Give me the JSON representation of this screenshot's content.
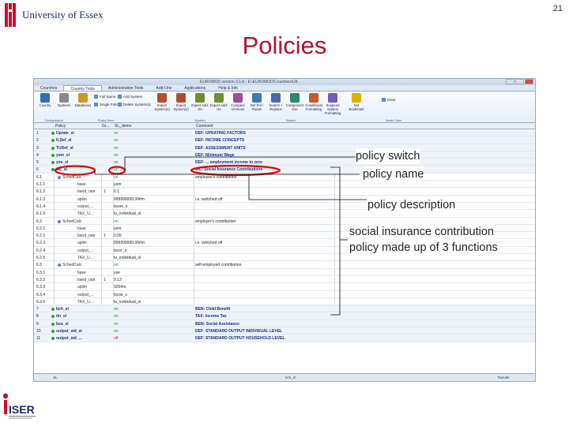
{
  "slide": {
    "logo_text": "University of Essex",
    "page_number": "21",
    "title": "Policies",
    "iser_logo_text": "ISER"
  },
  "app": {
    "window_title": "EUROMOD version 3.1.0 - E:\\EUROMOD\\Countries\\UK",
    "tabs": [
      "Countries",
      "Country Tools",
      "Administration Tools",
      "Add-Ons",
      "Applications",
      "Help & Info"
    ],
    "selected_tab": "Country Tools",
    "ribbon": {
      "buttons": [
        {
          "label": "Country",
          "icon": "globe-icon",
          "color": "#2f6fb8"
        },
        {
          "label": "Systems",
          "icon": "gear-icon",
          "color": "#8a8a8a"
        },
        {
          "label": "Databases",
          "icon": "database-icon",
          "color": "#c79a2b"
        },
        {
          "label": "Import System(s)",
          "icon": "import-icon",
          "color": "#b04f2a"
        },
        {
          "label": "Export System(s)",
          "icon": "export-icon",
          "color": "#b04f2a"
        },
        {
          "label": "Import Add-On",
          "icon": "import-addon-icon",
          "color": "#6f8f2a"
        },
        {
          "label": "Export Add-On",
          "icon": "export-addon-icon",
          "color": "#6f8f2a"
        },
        {
          "label": "Compare Versions",
          "icon": "compare-icon",
          "color": "#a04a9a"
        },
        {
          "label": "Ref Pol / Param",
          "icon": "reference-icon",
          "color": "#3a7ab8"
        },
        {
          "label": "Search + Replace",
          "icon": "search-icon",
          "color": "#4a6aa8"
        },
        {
          "label": "Component Use",
          "icon": "component-icon",
          "color": "#2a8a6a"
        },
        {
          "label": "Conditional Formatting",
          "icon": "format-icon",
          "color": "#c85a2a"
        },
        {
          "label": "Suspend System Formatting",
          "icon": "suspend-icon",
          "color": "#7a5ab8"
        },
        {
          "label": "Set Bookmark",
          "icon": "star-icon",
          "color": "#e0b000"
        }
      ],
      "small_buttons": [
        "Full Spine",
        "Single Policy",
        "Add System",
        "Delete System(s)",
        "Clear"
      ],
      "groups": [
        "Configuration",
        "Policy View",
        "System",
        "Search",
        "Node Color"
      ]
    },
    "columns": [
      "Policy",
      "Gr...",
      "SL_demo",
      "Comment"
    ],
    "rows": [
      {
        "n": "1",
        "policy": "Uprate_sl",
        "grp": "",
        "val": "on",
        "comment": "DEF: UPRATING FACTORS",
        "type": "policy"
      },
      {
        "n": "2",
        "policy": "ILDef_sl",
        "grp": "",
        "val": "on",
        "comment": "DEF: INCOME CONCEPTS",
        "type": "policy"
      },
      {
        "n": "3",
        "policy": "TUDef_sl",
        "grp": "",
        "val": "on",
        "comment": "DEF: ASSESSMENT UNITS",
        "type": "policy"
      },
      {
        "n": "4",
        "policy": "yem_sl",
        "grp": "",
        "val": "on",
        "comment": "DEF: Minimum Wage",
        "type": "policy"
      },
      {
        "n": "5",
        "policy": "yse_sl",
        "grp": "",
        "val": "on",
        "comment": "DEF: ... employment income to zero",
        "type": "policy"
      },
      {
        "n": "6",
        "policy": "sic_sl",
        "grp": "",
        "val": "on",
        "comment": "SIC: Social Insurance Contributions",
        "type": "policy"
      },
      {
        "n": "6.1",
        "policy": "SchedCalc",
        "grp": "",
        "val": "on",
        "comment": "employee's contribution",
        "type": "func"
      },
      {
        "n": "6.1.1",
        "policy": "base",
        "grp": "",
        "val": "yem",
        "comment": "",
        "type": "param"
      },
      {
        "n": "6.1.2",
        "policy": "band_rate",
        "grp": "1",
        "val": "0.1",
        "comment": "",
        "type": "param"
      },
      {
        "n": "6.1.3",
        "policy": "uplim",
        "grp": "",
        "val": "999999999.99#m",
        "comment": "i.e. switched off",
        "type": "param"
      },
      {
        "n": "6.1.4",
        "policy": "output_...",
        "grp": "",
        "val": "tscee_s",
        "comment": "",
        "type": "param"
      },
      {
        "n": "6.1.5",
        "policy": "TAX_U...",
        "grp": "",
        "val": "tu_individual_sl",
        "comment": "",
        "type": "param"
      },
      {
        "n": "6.2",
        "policy": "SchedCalc",
        "grp": "",
        "val": "on",
        "comment": "employer's contribution",
        "type": "func"
      },
      {
        "n": "6.2.1",
        "policy": "base",
        "grp": "",
        "val": "yem",
        "comment": "",
        "type": "param"
      },
      {
        "n": "6.2.2",
        "policy": "band_rate",
        "grp": "1",
        "val": "0.05",
        "comment": "",
        "type": "param"
      },
      {
        "n": "6.2.3",
        "policy": "uplim",
        "grp": "",
        "val": "999999999.99#m",
        "comment": "i.e. switched off",
        "type": "param"
      },
      {
        "n": "6.2.4",
        "policy": "output_...",
        "grp": "",
        "val": "tscer_s",
        "comment": "",
        "type": "param"
      },
      {
        "n": "6.2.5",
        "policy": "TAX_U...",
        "grp": "",
        "val": "tu_individual_sl",
        "comment": "",
        "type": "param"
      },
      {
        "n": "6.3",
        "policy": "SchedCalc",
        "grp": "",
        "val": "on",
        "comment": "self-employed contribution",
        "type": "func"
      },
      {
        "n": "6.3.1",
        "policy": "base",
        "grp": "",
        "val": "yse",
        "comment": "",
        "type": "param"
      },
      {
        "n": "6.3.2",
        "policy": "band_rate",
        "grp": "1",
        "val": "0.13",
        "comment": "",
        "type": "param"
      },
      {
        "n": "6.3.3",
        "policy": "uplim",
        "grp": "",
        "val": "325#m",
        "comment": "",
        "type": "param"
      },
      {
        "n": "6.3.4",
        "policy": "output_...",
        "grp": "",
        "val": "tscse_s",
        "comment": "",
        "type": "param"
      },
      {
        "n": "6.3.5",
        "policy": "TAX_U...",
        "grp": "",
        "val": "tu_individual_sl",
        "comment": "",
        "type": "param"
      },
      {
        "n": "7",
        "policy": "bch_sl",
        "grp": "",
        "val": "on",
        "comment": "BEN: Child Benefit",
        "type": "policy"
      },
      {
        "n": "8",
        "policy": "tin_sl",
        "grp": "",
        "val": "on",
        "comment": "TAX: Income Tax",
        "type": "policy"
      },
      {
        "n": "9",
        "policy": "bsa_sl",
        "grp": "",
        "val": "on",
        "comment": "BEN: Social Assistance",
        "type": "policy"
      },
      {
        "n": "10",
        "policy": "output_std_sl",
        "grp": "",
        "val": "on",
        "comment": "DEF: STANDARD OUTPUT INDIVIDUAL LEVEL",
        "type": "policy"
      },
      {
        "n": "11",
        "policy": "output_std_...",
        "grp": "",
        "val": "off",
        "comment": "DEF: STANDARD OUTPUT HOUSEHOLD LEVEL",
        "type": "policy"
      }
    ],
    "status_left": "SL",
    "status_mid": "bch_sl",
    "status_right": "Tax/uler"
  },
  "callouts": {
    "switch": "policy switch",
    "name": "policy name",
    "description": "policy description",
    "sic_line1": "social insurance contribution",
    "sic_line2": "policy made up of 3 functions"
  },
  "colors": {
    "title": "#b0132b",
    "annotation_red": "#e00000",
    "switch_on": "#2a8a2a",
    "switch_off": "#d03030"
  }
}
